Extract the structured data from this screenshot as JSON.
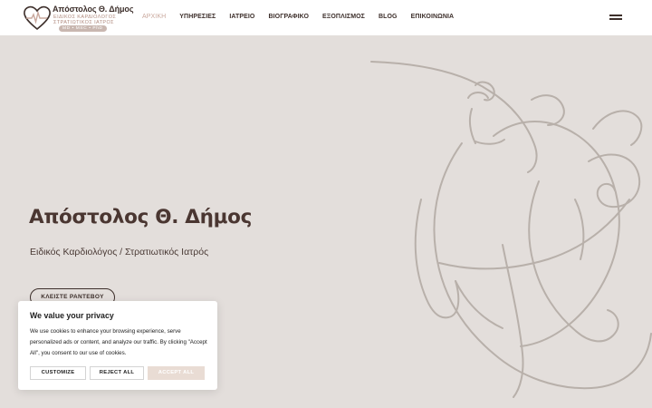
{
  "colors": {
    "background": "#e3dedb",
    "header": "#ffffff",
    "text_dark": "#3d2f2b",
    "nav_active": "#c9a89d",
    "accept_button": "#e9dcd4"
  },
  "logo": {
    "name": "Απόστολος Θ. Δήμος",
    "subtitle_line1": "ΕΙΔΙΚΟΣ ΚΑΡΔΙΟΛΟΓΟΣ",
    "subtitle_line2": "ΣΤΡΑΤΙΩΤΙΚΟΣ ΙΑΤΡΟΣ",
    "badge": "MD • MSC • PhD",
    "icon": "heart-pulse-icon"
  },
  "nav": {
    "items": [
      {
        "label": "ΑΡΧΙΚΗ",
        "active": true
      },
      {
        "label": "ΥΠΗΡΕΣΙΕΣ",
        "active": false
      },
      {
        "label": "ΙΑΤΡΕΙΟ",
        "active": false
      },
      {
        "label": "ΒΙΟΓΡΑΦΙΚΟ",
        "active": false
      },
      {
        "label": "ΕΞΟΠΛΙΣΜΟΣ",
        "active": false
      },
      {
        "label": "BLOG",
        "active": false
      },
      {
        "label": "ΕΠΙΚΟΙΝΩΝΙΑ",
        "active": false
      }
    ],
    "menu_icon": "hamburger-menu-icon"
  },
  "hero": {
    "title": "Απόστολος Θ. Δήμος",
    "subtitle": "Ειδικός Καρδιολόγος / Στρατιωτικός Ιατρός",
    "cta_label": "ΚΛΕΙΣΤΕ ΡΑΝΤΕΒΟΥ",
    "illustration": "line-art-heart-illustration"
  },
  "cookie_banner": {
    "title": "We value your privacy",
    "text": "We use cookies to enhance your browsing experience, serve personalized ads or content, and analyze our traffic. By clicking \"Accept All\", you consent to our use of cookies.",
    "customize_label": "CUSTOMIZE",
    "reject_label": "REJECT ALL",
    "accept_label": "ACCEPT ALL"
  }
}
